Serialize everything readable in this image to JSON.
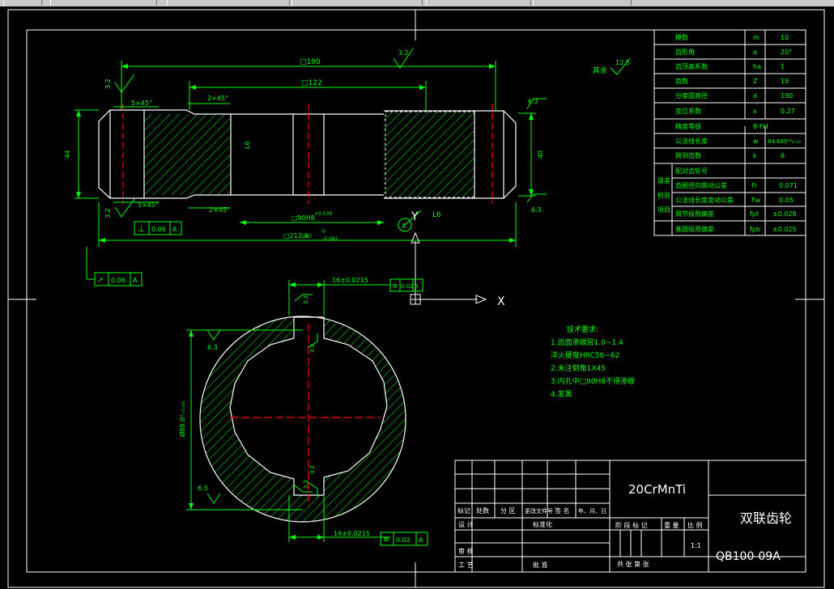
{
  "ui": {
    "coordinate_axes": {
      "x": "X",
      "y": "Y"
    },
    "colors": {
      "background": "#000000",
      "outline": "#ffffff",
      "dimension": "#00ff00",
      "center_line": "#ff0000",
      "hatch": "#00ff00"
    }
  },
  "drawing": {
    "front_view": {
      "dims": {
        "overall_top": "□190",
        "inner_top": "□122",
        "bottom_overall": "□212.3",
        "bottom_overall_suffix": "(Hd)",
        "bottom_tol_upper": "0",
        "bottom_tol_lower": "-0.081",
        "inner_bottom": "□90H8",
        "inner_tol": "+0.039",
        "height_left": "44",
        "height_right": "40",
        "chamfer_tl": "5×45°",
        "chamfer_tm": "2×45°",
        "chamfer_bl": "5×45°",
        "chamfer_bm": "2×45°",
        "l6_mid": "L6",
        "l6_datum": "L6",
        "datum_a": "A"
      },
      "roughness": {
        "top": "3.2",
        "left_top": "3.2",
        "left_bottom": "3.2",
        "right_top": "6.3",
        "right_bottom": "6.3",
        "rest_label": "其余",
        "rest_value": "12.5"
      },
      "tolerance_frames": {
        "perp": {
          "symbol": "⊥",
          "value": "0.06",
          "datum": "A"
        },
        "runout": {
          "symbol": "↗",
          "value": "0.06",
          "datum": "A"
        }
      }
    },
    "section_view": {
      "top_dim": "16±0.0215",
      "bottom_dim": "16±0.0215",
      "diameter": "Ø88.0⁰₋₀.₀₄",
      "sym_frame_top": {
        "symbol": "≡",
        "value": "0.02",
        "datum": "A"
      },
      "sym_frame_bottom": {
        "symbol": "≡",
        "value": "0.02",
        "datum": "A"
      },
      "roughness_top_1": "3.2",
      "roughness_top_2": "3.2",
      "roughness_bottom_1": "3.2",
      "roughness_bottom_2": "3.2",
      "roughness_left_top": "6.3",
      "roughness_left_bottom": "6.3"
    },
    "tech_requirements": {
      "title": "技术要求:",
      "lines": [
        "1.齿面渗碳层1.0~1.4",
        "  淬火硬度HRC56~62",
        "2.未注倒角1X45",
        "3.内孔中□90H8不得渗碳",
        "4.发黑"
      ]
    },
    "param_table": [
      {
        "name": "模数",
        "sym": "m",
        "val": "10"
      },
      {
        "name": "齿形角",
        "sym": "α",
        "val": "20°"
      },
      {
        "name": "齿顶高系数",
        "sym": "ha",
        "val": "1"
      },
      {
        "name": "齿数",
        "sym": "Z",
        "val": "19"
      },
      {
        "name": "分度圆直径",
        "sym": "d",
        "val": "190"
      },
      {
        "name": "变位系数",
        "sym": "x",
        "val": "0.27"
      },
      {
        "name": "精度等级",
        "sym": "",
        "val": "8-FH"
      },
      {
        "name": "公法线长度",
        "sym": "w",
        "val": "84.685¹²₀.₁₀"
      },
      {
        "name": "跨测齿数",
        "sym": "k",
        "val": "6"
      },
      {
        "name": "配对齿轮号",
        "sym": "",
        "val": ""
      }
    ],
    "param_group_label": [
      "误差",
      "检验",
      "项目"
    ],
    "param_check": [
      {
        "name": "齿圈径向跳动公差",
        "sym": "Fr",
        "val": "0.071"
      },
      {
        "name": "公法线长度变动公差",
        "sym": "Fw",
        "val": "0.05"
      },
      {
        "name": "周节极限偏差",
        "sym": "fpt",
        "val": "±0.028"
      },
      {
        "name": "基圆极限偏差",
        "sym": "fpb",
        "val": "±0.025"
      }
    ],
    "title_block": {
      "material": "20CrMnTi",
      "part_name": "双联齿轮",
      "drawing_no": "QB100-09A",
      "scale": "1:1",
      "header_cells": [
        "标记",
        "处数",
        "分 区",
        "更改文件号",
        "签 名",
        "年、月、日"
      ],
      "row_labels": [
        "设 计",
        "审 核",
        "工 艺"
      ],
      "standardize": "标准化",
      "approve": "批 准",
      "stage_headers": [
        "阶 段 标 记",
        "重 量",
        "比 例"
      ],
      "sheets": "共   张  第   张"
    }
  }
}
